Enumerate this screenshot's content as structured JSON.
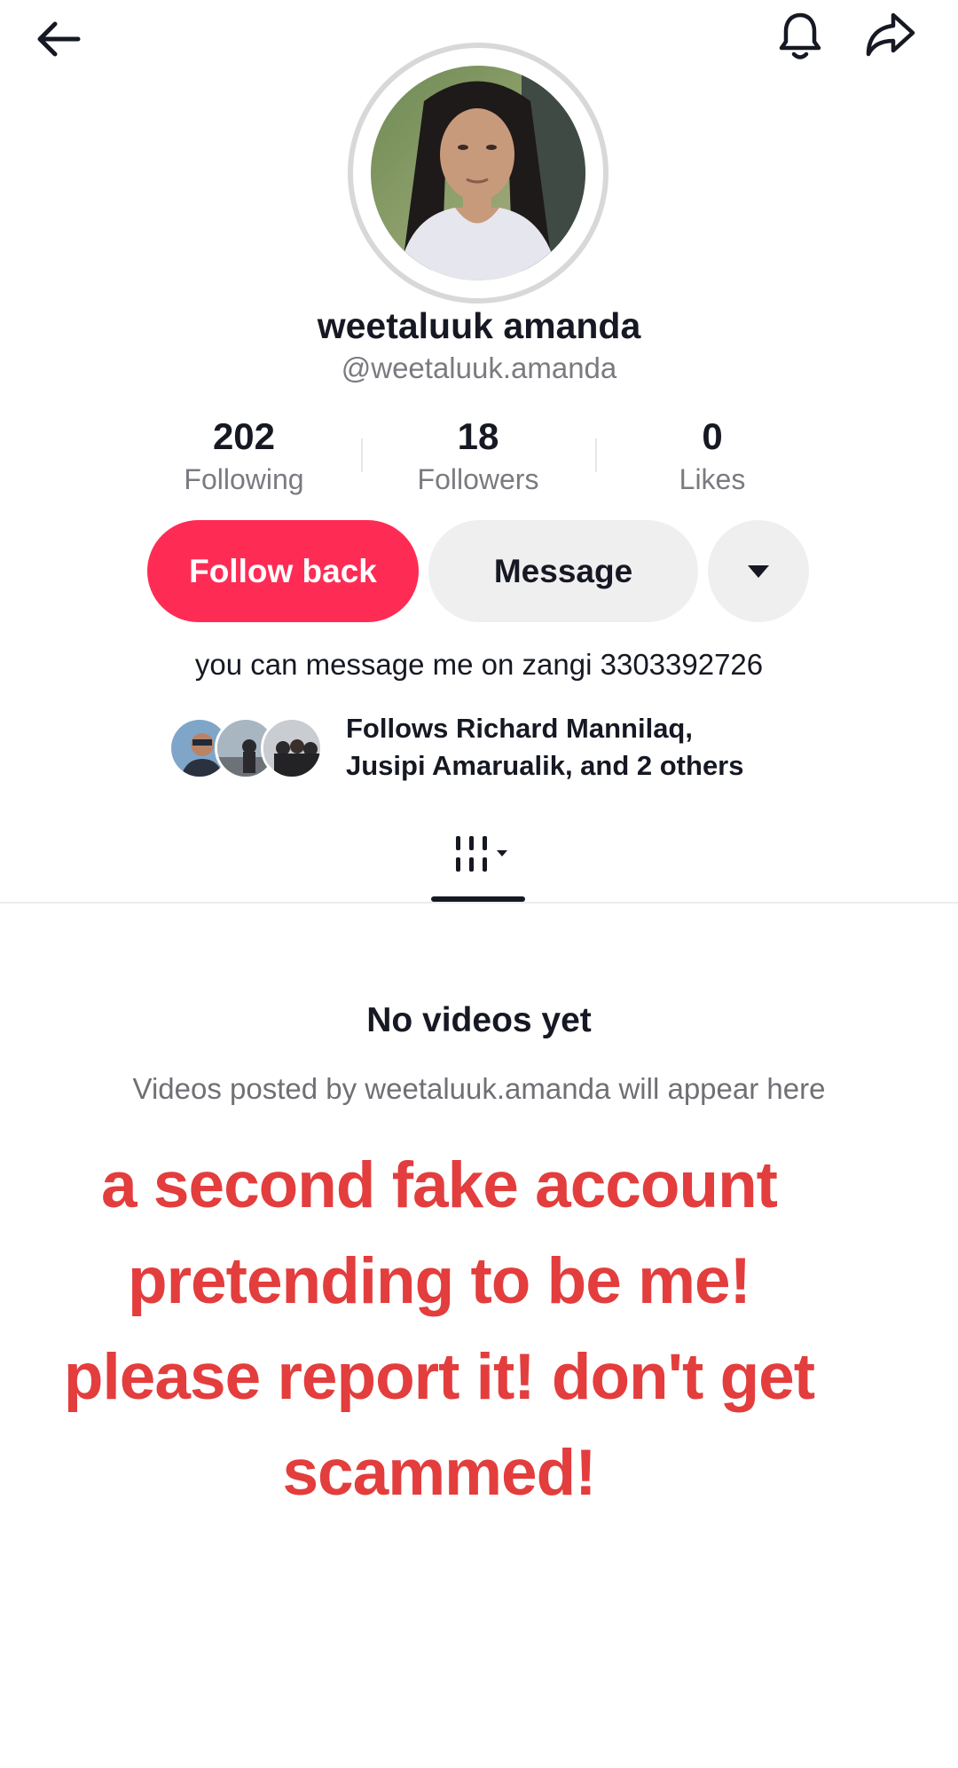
{
  "header": {
    "back_icon": "arrow-left-icon",
    "notification_icon": "bell-icon",
    "share_icon": "share-arrow-icon"
  },
  "profile": {
    "display_name": "weetaluuk amanda",
    "username": "@weetaluuk.amanda"
  },
  "stats": [
    {
      "value": "202",
      "label": "Following"
    },
    {
      "value": "18",
      "label": "Followers"
    },
    {
      "value": "0",
      "label": "Likes"
    }
  ],
  "actions": {
    "follow_label": "Follow back",
    "message_label": "Message",
    "more_icon": "caret-down-icon"
  },
  "bio": "you can message me on zangi 3303392726",
  "mutual": {
    "line1": "Follows Richard Mannilaq,",
    "line2": "Jusipi Amarualik, and 2 others"
  },
  "tabs": {
    "videos_icon": "videos-grid-icon"
  },
  "empty_state": {
    "title": "No videos yet",
    "subtitle": "Videos posted by weetaluuk.amanda will appear here"
  },
  "overlay": {
    "line1": "a second fake account",
    "line2": "pretending to be me!",
    "line3": "please report it! don't get",
    "line4": "scammed!"
  },
  "colors": {
    "accent": "#fe2c55",
    "overlay_text": "#e33d3d",
    "secondary_button": "#efeff0"
  }
}
